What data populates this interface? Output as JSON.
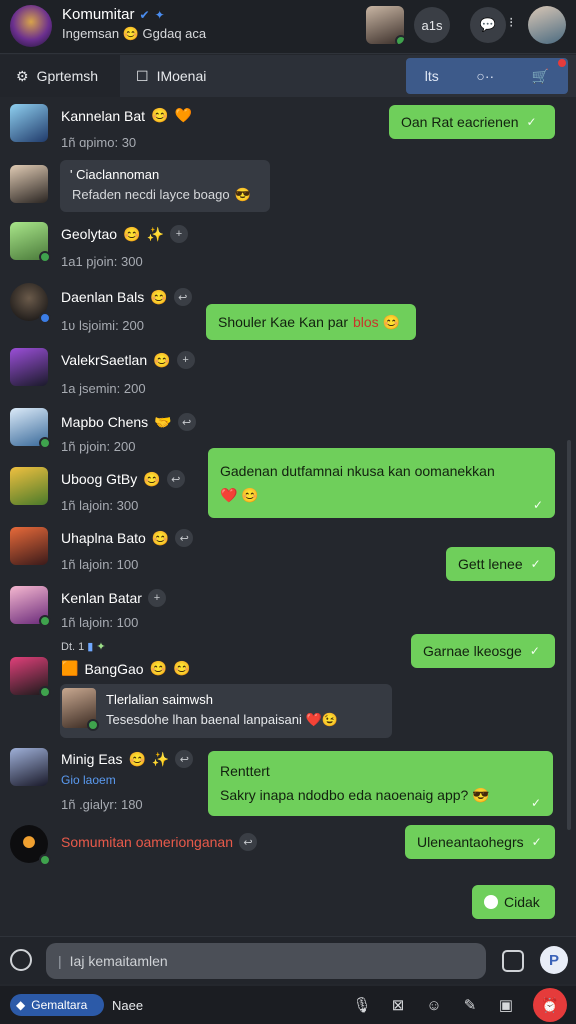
{
  "header": {
    "title": "Komumitar",
    "subtitle": "Ingemsan",
    "subtitle_tail": "Ggdaq aca",
    "right_label": "a1s"
  },
  "tabs": [
    {
      "label": "Gprtemsh",
      "active": true
    },
    {
      "label": "IMoenai",
      "active": false
    }
  ],
  "tab_actions": [
    "lts",
    "○··",
    "🛒"
  ],
  "messages": {
    "m1": {
      "name": "Kannelan Bat",
      "meta": "1ñ ɑpimo:   30"
    },
    "m2": {
      "title": "' Ciaclannoman",
      "text": "Refaden necdi layce boago"
    },
    "m3": {
      "name": "Geolytao",
      "meta": "1a1 pjoin:   300"
    },
    "m4": {
      "name": "Daenlan Bals",
      "meta": "1ʋ lsjoimi:   200"
    },
    "m5": {
      "name": "ValekrSaetlan",
      "meta": "1a jsemin:   200"
    },
    "m6": {
      "name": "Mapbo Chens",
      "meta": "1ñ pjoin:   200"
    },
    "m7": {
      "name": "Uboog GtBy",
      "meta": "1ñ lajoin:   300"
    },
    "m8": {
      "name": "Uhaplna Bato",
      "meta": "1ñ lajoin:   100"
    },
    "m9": {
      "name": "Kenlan Batar",
      "meta": "1ñ lajoin:   100"
    },
    "m10": {
      "prefix": "Dt. 1",
      "name": "BangGao",
      "quote_title": "Tlerlalian saimwsh",
      "quote_text": "Tesesdohe lhan baenal lanpaisani"
    },
    "m11": {
      "name": "Minig Eas",
      "sub": "Gio laoem",
      "meta": "1ñ .gialyr:   180"
    },
    "m12": {
      "text": "Somumitan oamerionganan"
    }
  },
  "outgoing": {
    "o1": "Oan Rat eacrienen",
    "o2": "Shouler Kae Kan par",
    "o2_tag": "blos",
    "o3_line1": "Gadenan dutfamnai nkusa kan oomanekkan",
    "o4": "Gett lenee",
    "o5": "Garnae lkeosge",
    "o6_line1": "Renttert",
    "o6_line2": "Sakry inapa ndodbo eda naoenaig app?",
    "o7": "Uleneantaohegrs",
    "o8": "Cidak"
  },
  "composer": {
    "placeholder": "Iaj kemaitamlen"
  },
  "bottombar": {
    "left_pill": "Gemaltara",
    "left_label": "Naee",
    "right_count": "1"
  },
  "colors": {
    "bubble_green": "#6fcf5b",
    "background": "#24272d",
    "accent_blue": "#3d5a8a",
    "fab_red": "#e53b3b"
  }
}
